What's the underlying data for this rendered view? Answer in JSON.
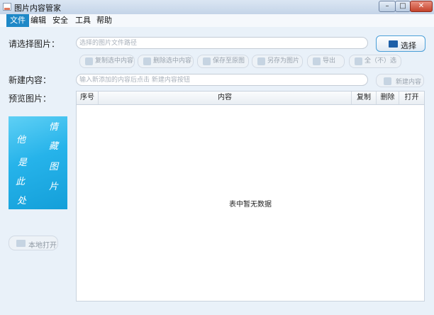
{
  "window": {
    "title": "图片内容管家",
    "controls": [
      "minimize-icon",
      "maximize-icon",
      "close-icon"
    ]
  },
  "menu": [
    "文件",
    "编辑",
    "安全",
    "工具",
    "帮助"
  ],
  "image_select": {
    "label": "请选择图片：",
    "placeholder": "选择的图片文件路径",
    "button": "选择"
  },
  "toolbar": {
    "copy": "复制选中内容",
    "delete": "删除选中内容",
    "save_original": "保存至原图",
    "save_as": "另存为图片",
    "export": "导出",
    "select_all": "全（不）选"
  },
  "new_content": {
    "label": "新建内容：",
    "placeholder": "输入新添加的内容后点击 新建内容按钮",
    "button": "新建内容"
  },
  "preview": {
    "label": "预览图片：",
    "image_chars": [
      "情",
      "藏",
      "图",
      "片",
      "他",
      "是",
      "此",
      "处"
    ],
    "open_button": "本地打开"
  },
  "table": {
    "headers": [
      "序号",
      "内容",
      "复制",
      "删除",
      "打开"
    ],
    "empty_text": "表中暂无数据"
  },
  "colors": {
    "accent": "#1e88c7",
    "preview_bg": "#26b3ea"
  }
}
